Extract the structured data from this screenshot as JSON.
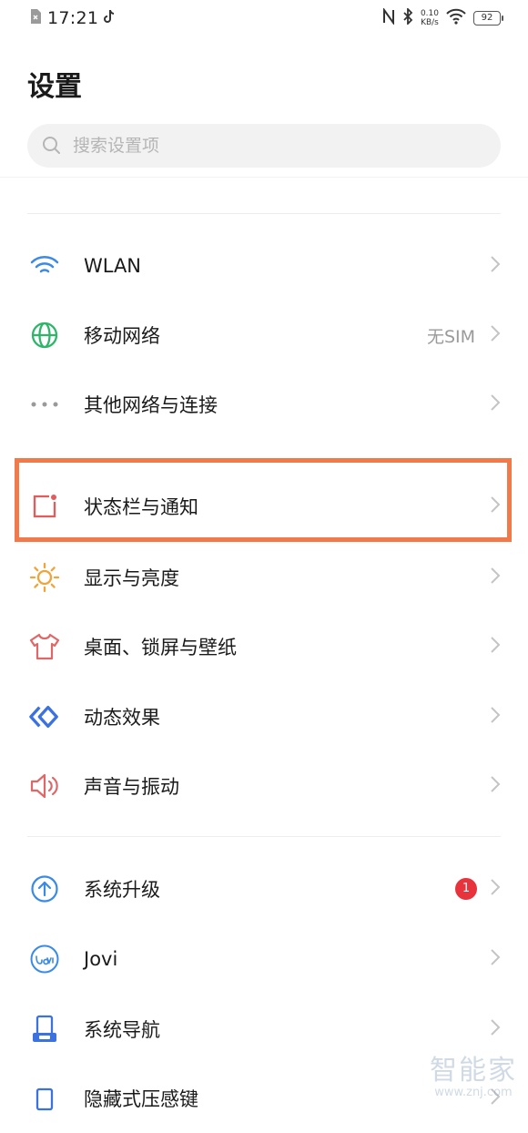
{
  "status_bar": {
    "time": "17:21",
    "net_speed_value": "0.10",
    "net_speed_unit": "KB/s",
    "battery": "92"
  },
  "page": {
    "title": "设置"
  },
  "search": {
    "placeholder": "搜索设置项"
  },
  "groups": [
    {
      "items": [
        {
          "label": "WLAN",
          "icon": "wifi-icon"
        },
        {
          "label": "移动网络",
          "value": "无SIM",
          "icon": "globe-icon"
        },
        {
          "label": "其他网络与连接",
          "icon": "more-dots-icon"
        }
      ]
    },
    {
      "items": [
        {
          "label": "状态栏与通知",
          "icon": "notification-icon",
          "highlighted": true
        },
        {
          "label": "显示与亮度",
          "icon": "sun-icon"
        },
        {
          "label": "桌面、锁屏与壁纸",
          "icon": "tshirt-icon"
        },
        {
          "label": "动态效果",
          "icon": "motion-effect-icon"
        },
        {
          "label": "声音与振动",
          "icon": "speaker-icon"
        }
      ]
    },
    {
      "items": [
        {
          "label": "系统升级",
          "icon": "upgrade-icon",
          "badge": "1"
        },
        {
          "label": "Jovi",
          "icon": "jovi-icon"
        },
        {
          "label": "系统导航",
          "icon": "navigation-icon"
        },
        {
          "label": "隐藏式压感键",
          "icon": "pressure-key-icon"
        }
      ]
    }
  ],
  "watermark": {
    "text": "智能家",
    "url": "www.znj.com"
  },
  "colors": {
    "highlight": "#f27a4a",
    "badge": "#e8333c",
    "wifi": "#3b8ae6",
    "globe": "#2fb56a",
    "notification": "#e25c5c",
    "sun": "#f0a43a",
    "tshirt": "#e06767",
    "motion": "#3b72e0",
    "speaker": "#e06767",
    "upgrade": "#3b8ae6"
  }
}
